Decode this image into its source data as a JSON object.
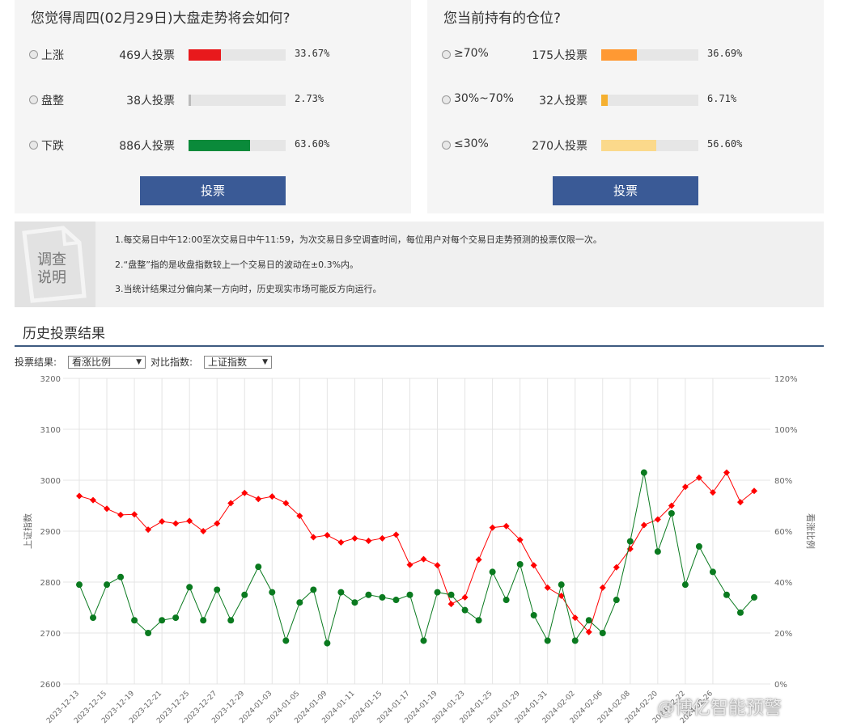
{
  "poll_market": {
    "question": "您觉得周四(02月29日)大盘走势将会如何?",
    "options": [
      {
        "label": "上涨",
        "count": "469人投票",
        "pct": "33.67%",
        "fraction": 0.3367,
        "color": "#e8191c"
      },
      {
        "label": "盘整",
        "count": "38人投票",
        "pct": "2.73%",
        "fraction": 0.0273,
        "color": "#bbbbbb"
      },
      {
        "label": "下跌",
        "count": "886人投票",
        "pct": "63.60%",
        "fraction": 0.636,
        "color": "#0a8a3a"
      }
    ],
    "vote_label": "投票"
  },
  "poll_position": {
    "question": "您当前持有的仓位?",
    "options": [
      {
        "label": "≥70%",
        "count": "175人投票",
        "pct": "36.69%",
        "fraction": 0.3669,
        "color": "#ff9933"
      },
      {
        "label": "30%~70%",
        "count": "32人投票",
        "pct": "6.71%",
        "fraction": 0.0671,
        "color": "#f5b030"
      },
      {
        "label": "≤30%",
        "count": "270人投票",
        "pct": "56.60%",
        "fraction": 0.566,
        "color": "#fbd98b"
      }
    ],
    "vote_label": "投票"
  },
  "notes": {
    "title_line1": "调查",
    "title_line2": "说明",
    "lines": [
      "1.每交易日中午12:00至次交易日中午11:59，为次交易日多空调查时间，每位用户对每个交易日走势预测的投票仅限一次。",
      "2.“盘整”指的是收盘指数较上一个交易日的波动在±0.3%内。",
      "3.当统计结果过分偏向某一方向时，历史现实市场可能反方向运行。"
    ]
  },
  "history": {
    "title": "历史投票结果",
    "result_label": "投票结果:",
    "result_value": "看涨比例",
    "compare_label": "对比指数:",
    "compare_value": "上证指数"
  },
  "watermark": "@博亿智能预警",
  "chart_data": {
    "type": "line",
    "xlabel": "",
    "ylabel": "上证指数",
    "ylabel_right": "看涨比例",
    "ylim": [
      2600,
      3200
    ],
    "ylim_right": [
      0,
      120
    ],
    "yticks": [
      "2600",
      "2700",
      "2800",
      "2900",
      "3000",
      "3100",
      "3200"
    ],
    "yticks_right": [
      "0%",
      "20%",
      "40%",
      "60%",
      "80%",
      "100%",
      "120%"
    ],
    "x_tick_labels": [
      "2023-12-13",
      "2023-12-15",
      "2023-12-19",
      "2023-12-21",
      "2023-12-25",
      "2023-12-27",
      "2023-12-29",
      "2024-01-03",
      "2024-01-05",
      "2024-01-09",
      "2024-01-11",
      "2024-01-15",
      "2024-01-17",
      "2024-01-19",
      "2024-01-23",
      "2024-01-25",
      "2024-01-29",
      "2024-01-31",
      "2024-02-02",
      "2024-02-06",
      "2024-02-08",
      "2024-02-20",
      "2024-02-22",
      "2024-02-26"
    ],
    "grid": true,
    "series": [
      {
        "name": "上证指数",
        "axis": "left",
        "color": "#ff0000",
        "marker": "diamond",
        "values": [
          2969,
          2961,
          2944,
          2932,
          2933,
          2903,
          2919,
          2915,
          2920,
          2900,
          2915,
          2955,
          2975,
          2963,
          2968,
          2955,
          2930,
          2888,
          2892,
          2878,
          2886,
          2881,
          2886,
          2893,
          2834,
          2845,
          2833,
          2757,
          2770,
          2844,
          2907,
          2910,
          2883,
          2833,
          2789,
          2773,
          2730,
          2702,
          2789,
          2829,
          2865,
          2912,
          2923,
          2950,
          2987,
          3005,
          2976,
          3015,
          2957,
          2979
        ]
      },
      {
        "name": "看涨比例",
        "axis": "right",
        "color": "#0a7a1f",
        "marker": "circle",
        "values": [
          39,
          26,
          39,
          42,
          25,
          20,
          25,
          26,
          38,
          25,
          37,
          25,
          35,
          46,
          36,
          17,
          32,
          37,
          16,
          36,
          32,
          35,
          34,
          33,
          35,
          17,
          36,
          35,
          29,
          25,
          44,
          33,
          47,
          27,
          17,
          39,
          17,
          25,
          20,
          33,
          56,
          83,
          52,
          67,
          39,
          54,
          44,
          35,
          28,
          34
        ]
      }
    ]
  }
}
